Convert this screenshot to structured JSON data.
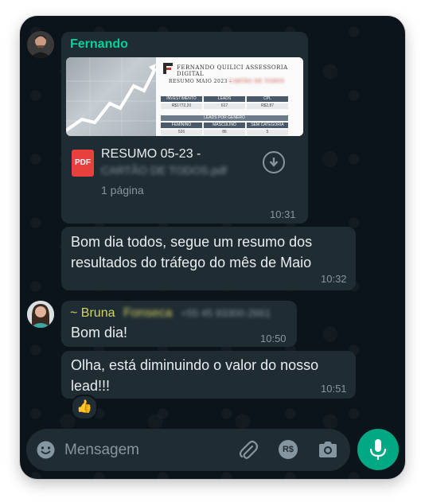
{
  "composer": {
    "placeholder": "Mensagem"
  },
  "messages": [
    {
      "sender": "Fernando",
      "sender_color": "#06cf9c",
      "document": {
        "preview_header": "FERNANDO QUILICI ASSESSORIA DIGITAL",
        "preview_subtitle": "RESUMO MAIO 2023 -",
        "preview_subtitle_blurred": "CARTÃO DE TODOS",
        "preview_table": {
          "headers": [
            "INVESTIMENTO",
            "LEADS",
            "CPL"
          ],
          "values": [
            "R$1772,20",
            "617",
            "R$2,87"
          ],
          "section": "LEADS POR GÊNERO",
          "gender_headers": [
            "FEMININO",
            "MASCULINO",
            "SEM CATEGORIA"
          ],
          "gender_values": [
            "526",
            "86",
            "5"
          ]
        },
        "name": "RESUMO 05-23 -",
        "name_blurred": "CARTÃO DE TODOS.pdf",
        "pages": "1 página",
        "type_badge": "PDF"
      },
      "time": "10:31"
    },
    {
      "text": "Bom dia todos, segue um resumo dos resultados do tráfego do mês de Maio",
      "time": "10:32"
    },
    {
      "sender": "~ Bruna",
      "sender_blurred": "Fonseca",
      "phone_blurred": "+55 45 93300-2661",
      "sender_color": "#d4d462",
      "text": "Bom dia!",
      "time": "10:50"
    },
    {
      "text": "Olha, está diminuindo o valor do nosso lead!!!",
      "time": "10:51",
      "reaction": "👍"
    }
  ],
  "colors": {
    "background": "#0b141a",
    "bubble": "#1f2c33",
    "accent": "#00a884",
    "pdf_badge": "#e8403d"
  },
  "icons": [
    "emoji-icon",
    "attach-icon",
    "payment-icon",
    "camera-icon",
    "mic-icon",
    "download-icon"
  ],
  "payment_icon_label": "R$"
}
